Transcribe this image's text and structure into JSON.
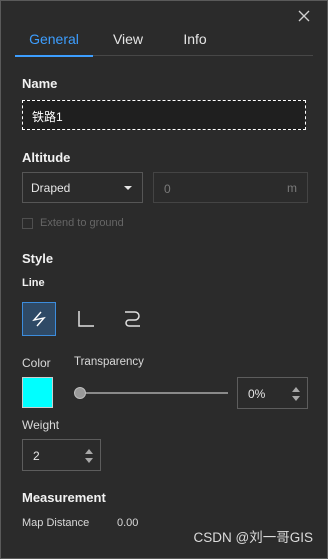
{
  "tabs": [
    {
      "label": "General",
      "active": true
    },
    {
      "label": "View",
      "active": false
    },
    {
      "label": "Info",
      "active": false
    }
  ],
  "name_section": {
    "title": "Name",
    "value": "铁路1"
  },
  "altitude_section": {
    "title": "Altitude",
    "mode_selected": "Draped",
    "offset_value": "0",
    "offset_unit": "m",
    "extend_label": "Extend to ground",
    "extend_checked": false
  },
  "style_section": {
    "title": "Style",
    "line_label": "Line",
    "line_types": [
      "straight-line-icon",
      "right-angle-line-icon",
      "curve-line-icon"
    ],
    "active_line_type": "straight-line-icon",
    "color_label": "Color",
    "color_value": "#00ffff",
    "transparency_label": "Transparency",
    "transparency_value": "0%",
    "transparency_fraction": 0,
    "weight_label": "Weight",
    "weight_value": "2"
  },
  "measurement_section": {
    "title": "Measurement",
    "map_distance_label": "Map Distance",
    "map_distance_value": "0.00"
  },
  "watermark": "CSDN @刘一哥GIS",
  "colors": {
    "accent": "#3d9eff",
    "background": "#2b2b2b"
  }
}
